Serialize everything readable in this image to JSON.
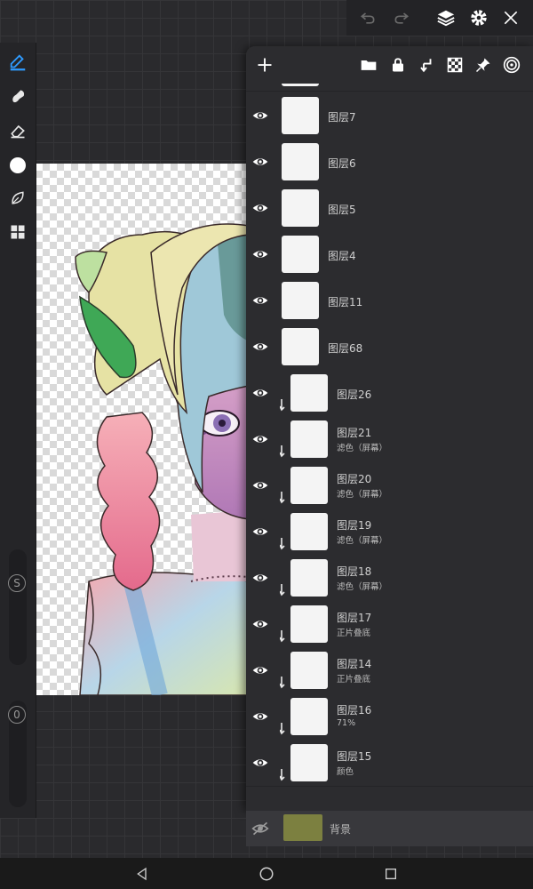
{
  "colors": {
    "accent": "#2f9bff",
    "panel": "#2c2c2f",
    "background_swatch": "#7c8040"
  },
  "toolbar": {
    "tools": [
      {
        "name": "brush-icon",
        "active": true
      },
      {
        "name": "smudge-icon"
      },
      {
        "name": "eraser-icon"
      },
      {
        "name": "color-icon"
      },
      {
        "name": "leaf-brush-icon"
      },
      {
        "name": "gallery-icon"
      }
    ],
    "size_label": "S",
    "opacity_label": "0"
  },
  "topbar": {
    "icons": [
      "undo-icon",
      "redo-icon",
      "layers-icon",
      "settings-icon",
      "close-icon"
    ]
  },
  "layer_panel": {
    "head_icons": [
      "add-icon",
      "folder-icon",
      "lock-icon",
      "merge-down-icon",
      "alpha-lock-icon",
      "pin-icon",
      "reference-icon"
    ],
    "layers": [
      {
        "name": "图层7",
        "mode": "",
        "clip": false
      },
      {
        "name": "图层6",
        "mode": "",
        "clip": false
      },
      {
        "name": "图层5",
        "mode": "",
        "clip": false
      },
      {
        "name": "图层4",
        "mode": "",
        "clip": false
      },
      {
        "name": "图层11",
        "mode": "",
        "clip": false
      },
      {
        "name": "图层68",
        "mode": "",
        "clip": false
      },
      {
        "name": "图层26",
        "mode": "",
        "clip": true
      },
      {
        "name": "图层21",
        "mode": "滤色（屏幕）",
        "clip": true
      },
      {
        "name": "图层20",
        "mode": "滤色（屏幕）",
        "clip": true
      },
      {
        "name": "图层19",
        "mode": "滤色（屏幕）",
        "clip": true
      },
      {
        "name": "图层18",
        "mode": "滤色（屏幕）",
        "clip": true
      },
      {
        "name": "图层17",
        "mode": "正片叠底",
        "clip": true
      },
      {
        "name": "图层14",
        "mode": "正片叠底",
        "clip": true
      },
      {
        "name": "图层16",
        "mode": "71%",
        "clip": true
      },
      {
        "name": "图层15",
        "mode": "颜色",
        "clip": true
      }
    ],
    "background_label": "背景"
  },
  "navbar": {
    "icons": [
      "back-icon",
      "home-icon",
      "recents-icon"
    ]
  }
}
